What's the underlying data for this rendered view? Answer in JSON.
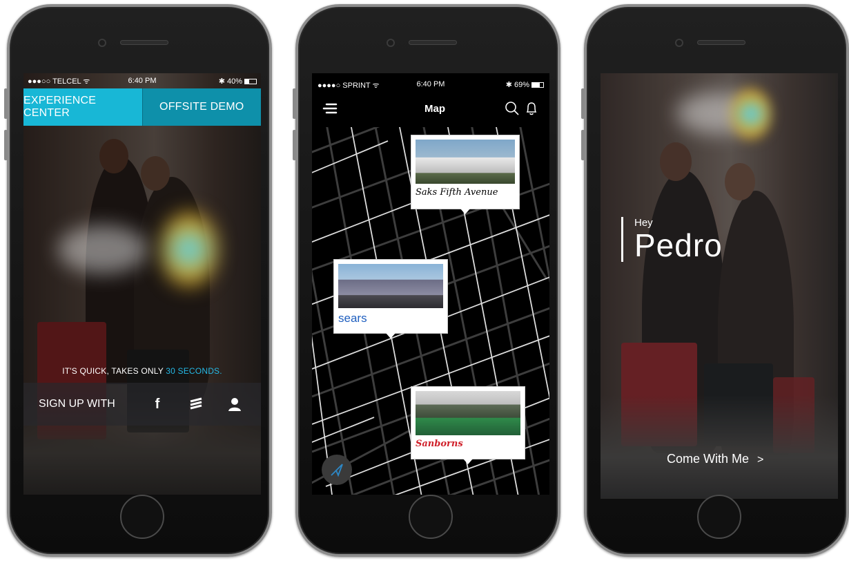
{
  "phone1": {
    "status": {
      "carrier": "●●●○○ TELCEL ᯤ",
      "time": "6:40 PM",
      "battery": "✱ 40%",
      "battery_level": 0.4
    },
    "tabs": [
      {
        "label": "EXPERIENCE CENTER"
      },
      {
        "label": "OFFSITE DEMO"
      }
    ],
    "tagline": {
      "prefix": "IT'S QUICK, TAKES ONLY ",
      "highlight": "30 SECONDS."
    },
    "signup": {
      "label": "SIGN UP WITH",
      "options": [
        {
          "icon": "facebook-icon",
          "glyph": "f"
        },
        {
          "icon": "stack-icon",
          "glyph": "≋"
        },
        {
          "icon": "user-icon",
          "glyph": "👤"
        }
      ]
    },
    "colors": {
      "tab_active": "#18b7d6",
      "tab_inactive": "#0e90aa",
      "highlight": "#25b9e6"
    }
  },
  "phone2": {
    "status": {
      "carrier": "●●●●○ SPRINT ᯤ",
      "time": "6:40 PM",
      "battery": "✱ 69%",
      "battery_level": 0.69
    },
    "header": {
      "title": "Map",
      "menu_icon": "menu-icon",
      "search_icon": "search-icon",
      "bell_icon": "bell-icon"
    },
    "pins": [
      {
        "brand": "Saks Fifth Avenue",
        "sign": "SAKS FIFTH AVENUE"
      },
      {
        "brand": "sears"
      },
      {
        "brand": "Sanborns",
        "sign": "Sanborns"
      }
    ],
    "compass_icon": "compass-icon"
  },
  "phone3": {
    "greeting": {
      "small": "Hey",
      "name": "Pedro"
    },
    "cta": {
      "label": "Come With Me",
      "chevron": ">"
    }
  }
}
